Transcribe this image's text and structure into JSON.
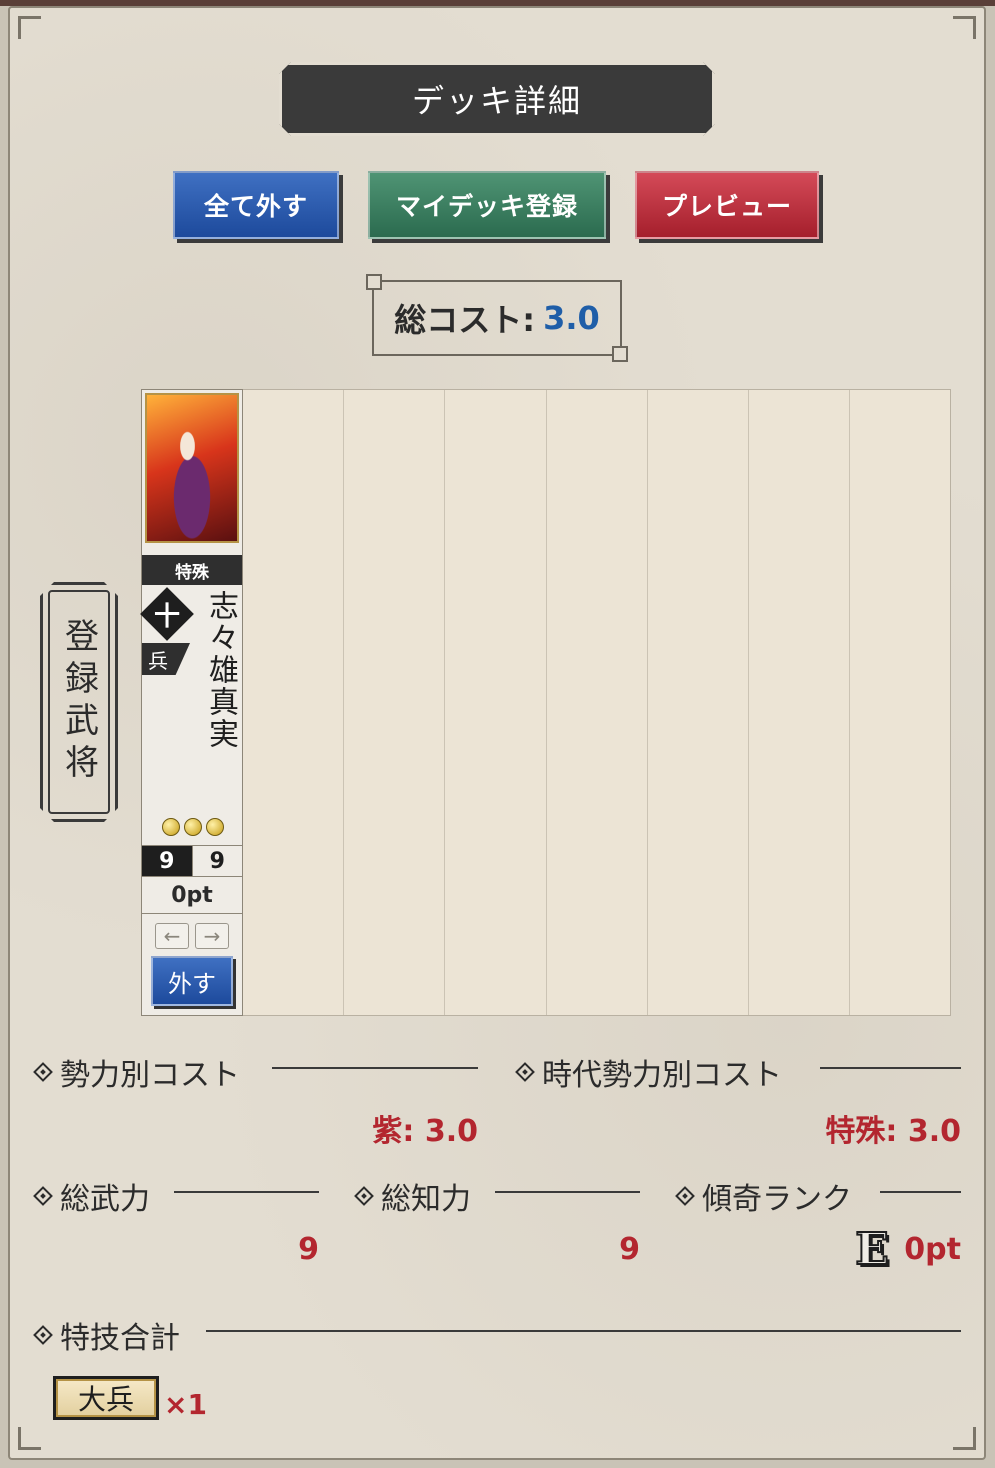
{
  "header": {
    "title": "デッキ詳細"
  },
  "toolbar": {
    "remove_all_label": "全て外す",
    "register_mydeck_label": "マイデッキ登録",
    "preview_label": "プレビュー"
  },
  "total_cost": {
    "label": "総コスト:",
    "value": "3.0"
  },
  "registered_label": "登録武将",
  "card": {
    "type": "特殊",
    "clan_symbol": "十",
    "unit": "兵",
    "name": "志々雄真実",
    "rank_coins": 3,
    "strength": "9",
    "intelligence": "9",
    "points": "0pt",
    "arrow_left": "←",
    "arrow_right": "→",
    "remove_label": "外す"
  },
  "empty_slots": 7,
  "sections": {
    "faction_cost": {
      "title": "勢力別コスト",
      "value": "紫: 3.0"
    },
    "era_faction_cost": {
      "title": "時代勢力別コスト",
      "value": "特殊: 3.0"
    },
    "total_strength": {
      "title": "総武力",
      "value": "9"
    },
    "total_intelligence": {
      "title": "総知力",
      "value": "9"
    },
    "eccentric_rank": {
      "title": "傾奇ランク",
      "rank": "E",
      "value": "0pt"
    },
    "skill_total": {
      "title": "特技合計",
      "skill": "大兵",
      "count": "×1"
    }
  },
  "colors": {
    "accent_red": "#b3262f",
    "accent_blue": "#1f5ea8",
    "button_blue": "#1d4a9c",
    "button_green": "#2b6b4f",
    "button_red": "#a51f2c"
  }
}
